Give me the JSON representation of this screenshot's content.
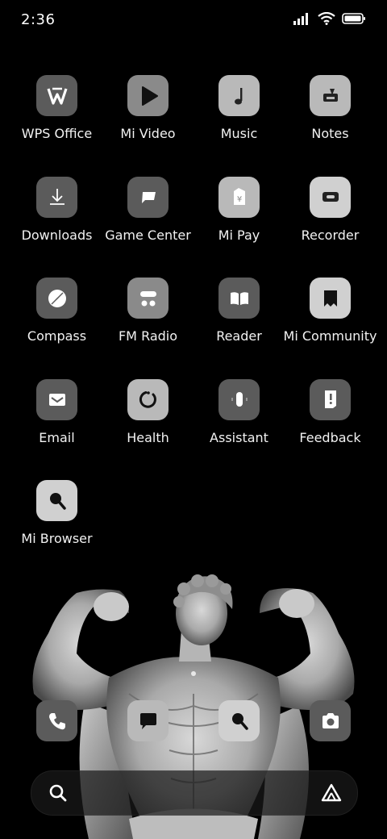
{
  "status_bar": {
    "time": "2:36",
    "icons": [
      "signal-icon",
      "wifi-icon",
      "battery-icon"
    ]
  },
  "apps": [
    {
      "label": "WPS Office",
      "icon": "wps-office-icon"
    },
    {
      "label": "Mi Video",
      "icon": "play-icon"
    },
    {
      "label": "Music",
      "icon": "music-note-icon"
    },
    {
      "label": "Notes",
      "icon": "notes-icon"
    },
    {
      "label": "Downloads",
      "icon": "download-icon"
    },
    {
      "label": "Game Center",
      "icon": "game-center-icon"
    },
    {
      "label": "Mi Pay",
      "icon": "wallet-icon"
    },
    {
      "label": "Recorder",
      "icon": "recorder-icon"
    },
    {
      "label": "Compass",
      "icon": "compass-icon"
    },
    {
      "label": "FM Radio",
      "icon": "radio-icon"
    },
    {
      "label": "Reader",
      "icon": "book-icon"
    },
    {
      "label": "Mi Community",
      "icon": "community-icon"
    },
    {
      "label": "Email",
      "icon": "email-icon"
    },
    {
      "label": "Health",
      "icon": "health-icon"
    },
    {
      "label": "Assistant",
      "icon": "assistant-mic-icon"
    },
    {
      "label": "Feedback",
      "icon": "feedback-icon"
    },
    {
      "label": "Mi Browser",
      "icon": "browser-search-icon"
    }
  ],
  "dock": [
    {
      "icon": "phone-icon"
    },
    {
      "icon": "message-icon"
    },
    {
      "icon": "browser-icon"
    },
    {
      "icon": "camera-icon"
    }
  ],
  "page_indicator": {
    "pages": 1,
    "current": 1
  },
  "search_bar": {
    "left_icon": "search-icon",
    "right_icon": "assistant-icon"
  },
  "wallpaper": "marble-statue-flexing"
}
